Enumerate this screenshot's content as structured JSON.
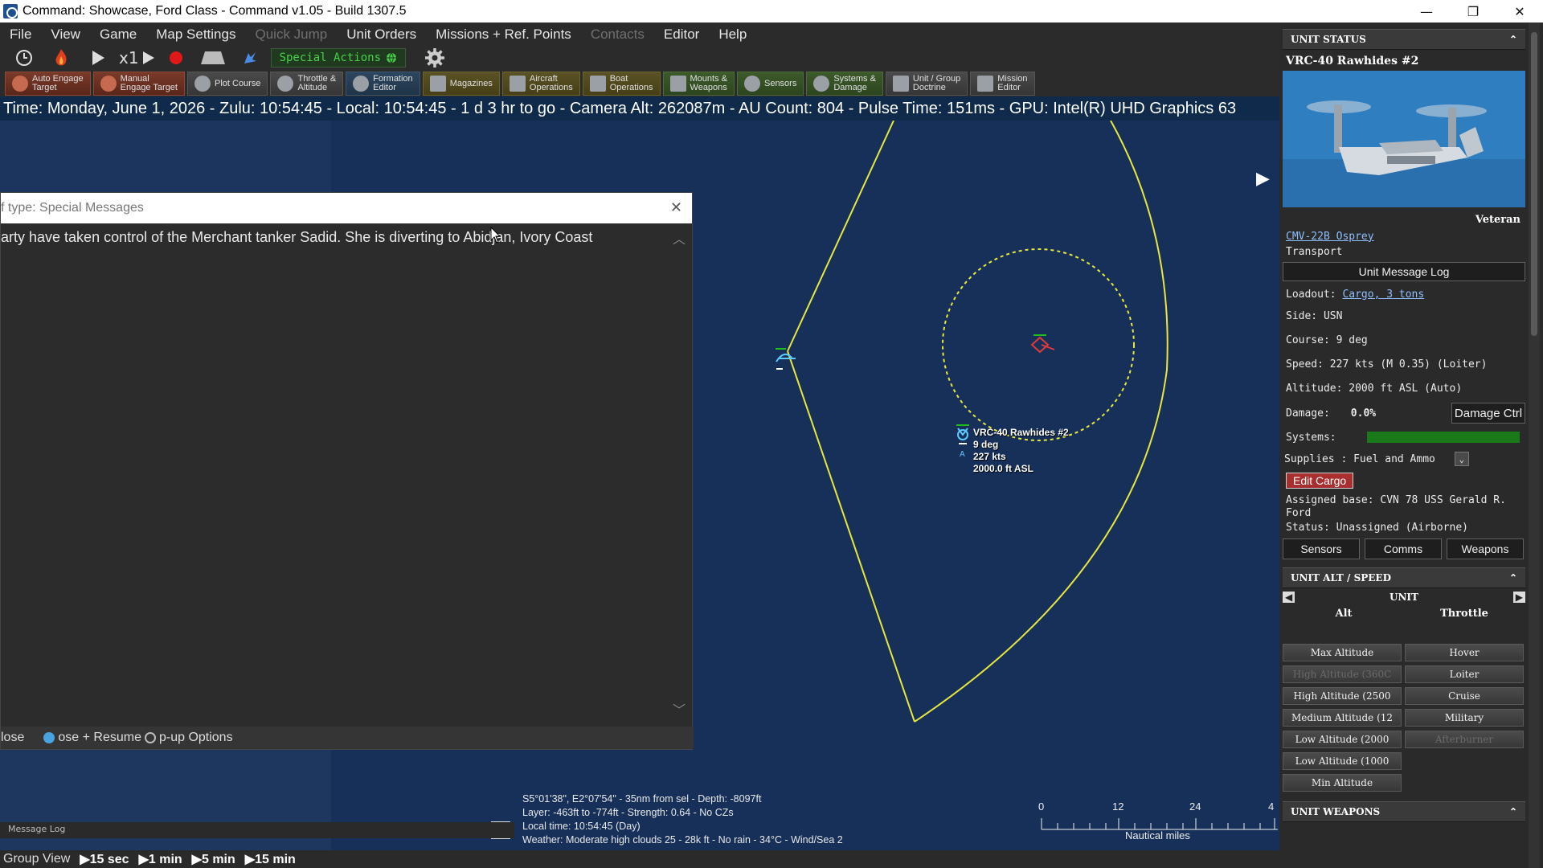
{
  "window": {
    "title": "Command: Showcase, Ford Class - Command v1.05 - Build 1307.5",
    "minimize": "—",
    "restore": "❐",
    "close": "✕"
  },
  "menu": {
    "items": [
      {
        "label": "File",
        "enabled": true
      },
      {
        "label": "View",
        "enabled": true
      },
      {
        "label": "Game",
        "enabled": true
      },
      {
        "label": "Map Settings",
        "enabled": true
      },
      {
        "label": "Quick Jump",
        "enabled": false
      },
      {
        "label": "Unit Orders",
        "enabled": true
      },
      {
        "label": "Missions + Ref. Points",
        "enabled": true
      },
      {
        "label": "Contacts",
        "enabled": false
      },
      {
        "label": "Editor",
        "enabled": true
      },
      {
        "label": "Help",
        "enabled": true
      }
    ]
  },
  "controls": {
    "time_compression": "x1",
    "special_actions": "Special Actions"
  },
  "toolbar": {
    "buttons": [
      {
        "label": "Auto Engage\nTarget",
        "style": "red",
        "icon": "crosshair-icon"
      },
      {
        "label": "Manual\nEngage Target",
        "style": "red",
        "icon": "crosshair-icon"
      },
      {
        "label": "Plot Course",
        "style": "",
        "icon": "course-icon"
      },
      {
        "label": "Throttle &\nAltitude",
        "style": "",
        "icon": "throttle-icon"
      },
      {
        "label": "Formation\nEditor",
        "style": "blue",
        "icon": "formation-icon"
      },
      {
        "label": "Magazines",
        "style": "olive",
        "icon": "magazines-icon"
      },
      {
        "label": "Aircraft\nOperations",
        "style": "olive",
        "icon": "aircraft-icon"
      },
      {
        "label": "Boat\nOperations",
        "style": "olive",
        "icon": "boat-icon"
      },
      {
        "label": "Mounts &\nWeapons",
        "style": "green",
        "icon": "weapons-icon"
      },
      {
        "label": "Sensors",
        "style": "green",
        "icon": "sensors-icon"
      },
      {
        "label": "Systems &\nDamage",
        "style": "green",
        "icon": "systems-icon"
      },
      {
        "label": "Unit / Group\nDoctrine",
        "style": "",
        "icon": "doctrine-icon"
      },
      {
        "label": "Mission\nEditor",
        "style": "",
        "icon": "mission-icon"
      }
    ]
  },
  "status_line": "Time: Monday, June 1, 2026 - Zulu: 10:54:45 - Local: 10:54:45 - 1 d 3 hr to go - Camera Alt: 262087m - AU Count: 804 - Pulse Time: 151ms - GPU: Intel(R) UHD Graphics 63",
  "message_window": {
    "title": "f type: Special Messages",
    "message": "arty have taken control of the Merchant tanker Sadid. She is diverting to Abidjan, Ivory Coast",
    "footer_close": "lose",
    "footer_close_resume": "ose + Resume",
    "footer_popup": "p-up Options"
  },
  "map": {
    "unit_label": {
      "name": "VRC-40 Rawhides #2",
      "course": "9 deg",
      "speed": "227 kts",
      "altitude": "2000.0 ft ASL"
    },
    "cursor_info": {
      "position": "S5°01'38\", E2°07'54\" - 35nm from sel - Depth: -8097ft",
      "layer": "Layer: -463ft to -774ft - Strength: 0.64 - No CZs",
      "local_time": "Local time: 10:54:45 (Day)",
      "weather": "Weather: Moderate high clouds 25 - 28k ft - No rain - 34°C - Wind/Sea 2"
    },
    "scale": {
      "ticks": [
        "0",
        "12",
        "24",
        "4"
      ],
      "unit": "Nautical miles"
    },
    "message_log_tab": "Message Log"
  },
  "bottom_bar": {
    "group_view": "Group View",
    "speeds": [
      "15 sec",
      "1 min",
      "5 min",
      "15 min"
    ]
  },
  "unit_status": {
    "header": "UNIT STATUS",
    "unit_name": "VRC-40 Rawhides #2",
    "proficiency": "Veteran",
    "class_link": "CMV-22B Osprey",
    "role": "Transport",
    "message_log_button": "Unit Message Log",
    "loadout_label": "Loadout:",
    "loadout_value": "Cargo, 3 tons",
    "side": "Side: USN",
    "course": "Course: 9 deg",
    "speed": "Speed: 227 kts (M 0.35)  (Loiter)",
    "altitude": "Altitude: 2000 ft ASL (Auto)",
    "damage_label": "Damage:",
    "damage_value": "0.0%",
    "damage_button": "Damage Ctrl",
    "systems_label": "Systems:",
    "supplies_label": "Supplies :",
    "supplies_value": "Fuel and Ammo",
    "edit_cargo": "Edit Cargo",
    "assigned_base": "Assigned base: CVN 78 USS Gerald R.",
    "assigned_base_cont": "Ford",
    "status": "Status: Unassigned (Airborne)",
    "tabs": [
      "Sensors",
      "Comms",
      "Weapons"
    ]
  },
  "alt_speed": {
    "header": "UNIT ALT / SPEED",
    "mode": "UNIT",
    "col_alt": "Alt",
    "col_throttle": "Throttle",
    "alt_buttons": [
      {
        "label": "Max Altitude",
        "enabled": true
      },
      {
        "label": "High Altitude (360C",
        "enabled": false
      },
      {
        "label": "High Altitude (2500",
        "enabled": true
      },
      {
        "label": "Medium Altitude (12",
        "enabled": true
      },
      {
        "label": "Low Altitude (2000",
        "enabled": true
      },
      {
        "label": "Low Altitude (1000",
        "enabled": true
      },
      {
        "label": "Min Altitude",
        "enabled": true
      }
    ],
    "throttle_buttons": [
      {
        "label": "Hover",
        "enabled": true
      },
      {
        "label": "Loiter",
        "enabled": true
      },
      {
        "label": "Cruise",
        "enabled": true
      },
      {
        "label": "Military",
        "enabled": true
      },
      {
        "label": "Afterburner",
        "enabled": false
      }
    ]
  },
  "unit_weapons": {
    "header": "UNIT WEAPONS"
  },
  "colors": {
    "map_sea": "#17305a",
    "range_ring": "#e8e83c",
    "friendly": "#5ec8ff",
    "hostile": "#e03a3a",
    "systems_bar": "#1a7a1a"
  }
}
